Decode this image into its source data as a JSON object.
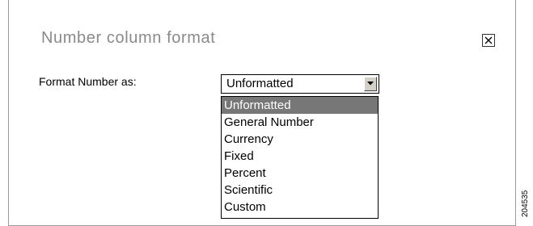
{
  "dialog": {
    "title": "Number column format",
    "close_icon": "close-icon"
  },
  "form": {
    "label": "Format Number as:",
    "select": {
      "value": "Unformatted",
      "arrow_icon": "chevron-down-icon",
      "options": [
        "Unformatted",
        "General Number",
        "Currency",
        "Fixed",
        "Percent",
        "Scientific",
        "Custom"
      ],
      "selected_index": 0
    }
  },
  "figure_id": "204535",
  "colors": {
    "title": "#8a8a8a",
    "highlight": "#777777",
    "border": "#9a9a9a"
  }
}
